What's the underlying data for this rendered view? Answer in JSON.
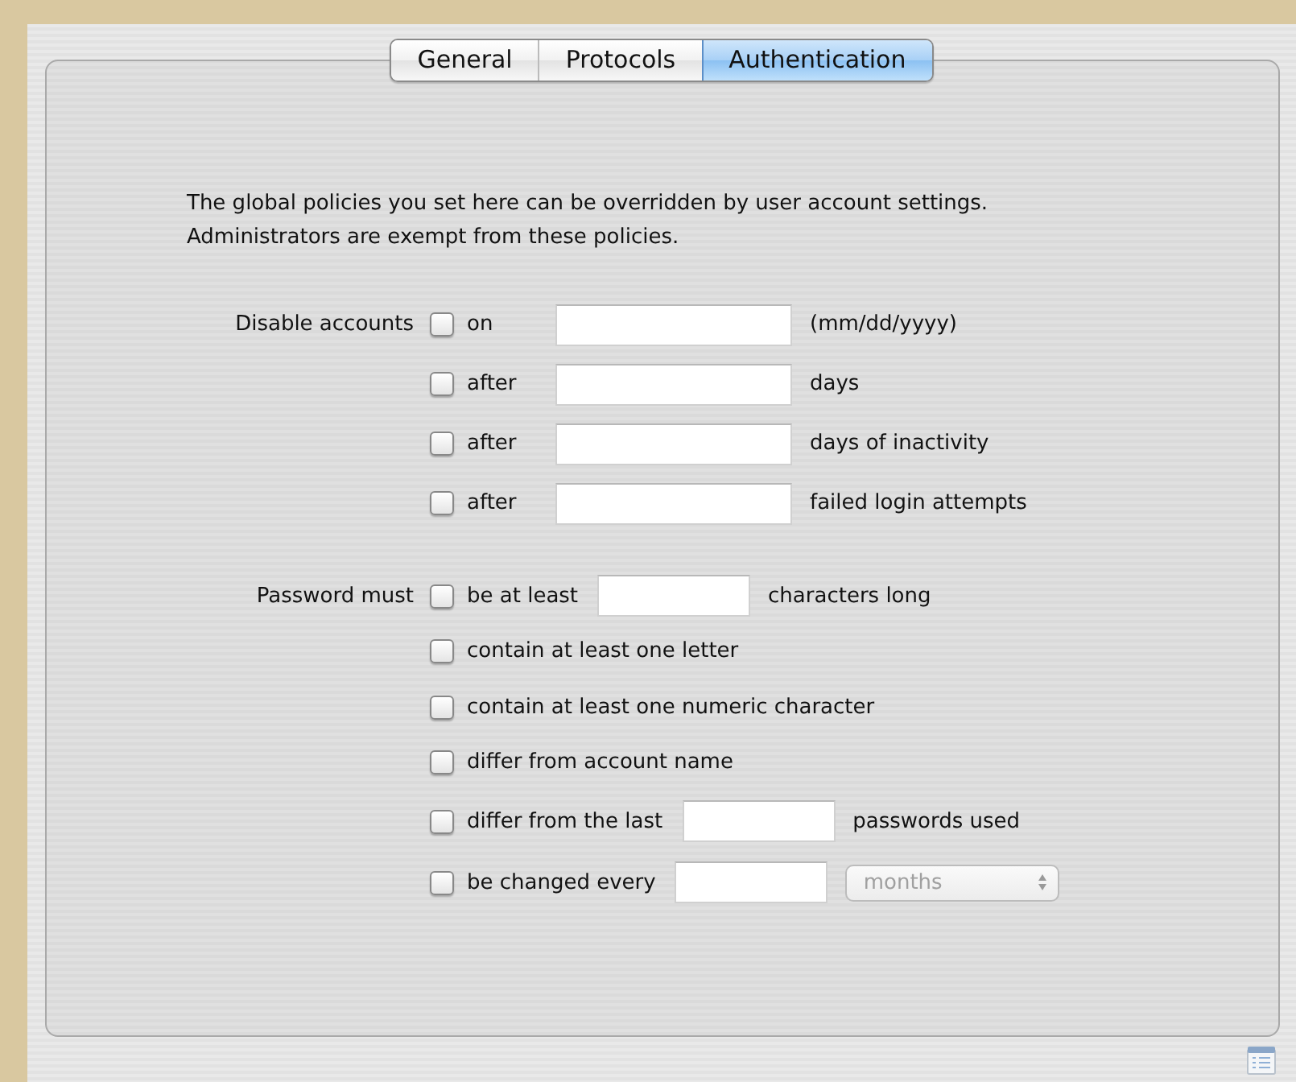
{
  "tabs": [
    {
      "label": "General",
      "selected": false
    },
    {
      "label": "Protocols",
      "selected": false
    },
    {
      "label": "Authentication",
      "selected": true
    }
  ],
  "intro": [
    "The global policies you set here can be overridden by user account settings.",
    "Administrators are exempt from these policies."
  ],
  "groups": [
    {
      "kind": "aligned",
      "label": "Disable accounts",
      "rows": [
        {
          "kind": "field",
          "text": "on",
          "checked": false,
          "suffix": "(mm/dd/yyyy)"
        },
        {
          "kind": "field",
          "text": "after",
          "checked": false,
          "suffix": "days"
        },
        {
          "kind": "field",
          "text": "after",
          "checked": false,
          "suffix": "days of inactivity"
        },
        {
          "kind": "field",
          "text": "after",
          "checked": false,
          "suffix": "failed login attempts"
        }
      ]
    },
    {
      "kind": "flow",
      "label": "Password must",
      "rows": [
        {
          "kind": "field",
          "text": "be at least",
          "checked": false,
          "suffix": "characters long"
        },
        {
          "kind": "plain",
          "text": "contain at least one letter",
          "checked": false
        },
        {
          "kind": "plain",
          "text": "contain at least one numeric character",
          "checked": false
        },
        {
          "kind": "plain",
          "text": "differ from account name",
          "checked": false
        },
        {
          "kind": "field",
          "text": "differ from the last",
          "checked": false,
          "suffix": "passwords used"
        },
        {
          "kind": "popup",
          "text": "be changed every",
          "checked": false,
          "popup": {
            "value": "months",
            "disabled": true
          }
        }
      ]
    }
  ]
}
